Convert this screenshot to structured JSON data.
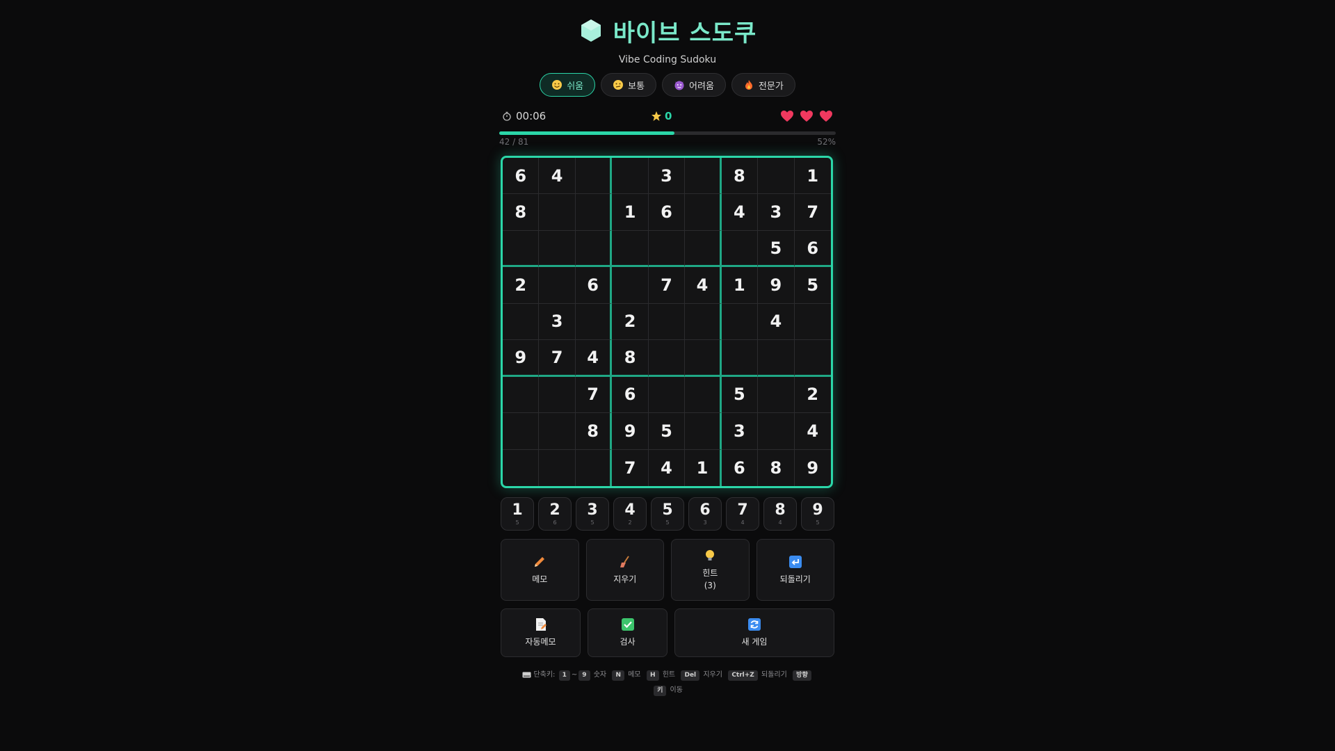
{
  "app": {
    "title": "바이브 스도쿠",
    "subtitle": "Vibe Coding Sudoku",
    "accent": "#2bd6a8"
  },
  "difficulty": [
    {
      "label": "쉬움",
      "icon": "smile-emoji-icon",
      "active": true
    },
    {
      "label": "보통",
      "icon": "thinking-emoji-icon",
      "active": false
    },
    {
      "label": "어려움",
      "icon": "devil-emoji-icon",
      "active": false
    },
    {
      "label": "전문가",
      "icon": "fire-emoji-icon",
      "active": false
    }
  ],
  "status": {
    "timer": "00:06",
    "score": "0",
    "lives": 3
  },
  "progress": {
    "label": "42 / 81",
    "percent_label": "52%",
    "fraction": 0.52
  },
  "grid": [
    [
      "6",
      "4",
      "",
      "",
      "3",
      "",
      "8",
      "",
      "1"
    ],
    [
      "8",
      "",
      "",
      "1",
      "6",
      "",
      "4",
      "3",
      "7"
    ],
    [
      "",
      "",
      "",
      "",
      "",
      "",
      "",
      "5",
      "6"
    ],
    [
      "2",
      "",
      "6",
      "",
      "7",
      "4",
      "1",
      "9",
      "5"
    ],
    [
      "",
      "3",
      "",
      "2",
      "",
      "",
      "",
      "4",
      ""
    ],
    [
      "9",
      "7",
      "4",
      "8",
      "",
      "",
      "",
      "",
      ""
    ],
    [
      "",
      "",
      "7",
      "6",
      "",
      "",
      "5",
      "",
      "2"
    ],
    [
      "",
      "",
      "8",
      "9",
      "5",
      "",
      "3",
      "",
      "4"
    ],
    [
      "",
      "",
      "",
      "7",
      "4",
      "1",
      "6",
      "8",
      "9"
    ]
  ],
  "numpad": [
    {
      "value": "1",
      "count": "5"
    },
    {
      "value": "2",
      "count": "6"
    },
    {
      "value": "3",
      "count": "5"
    },
    {
      "value": "4",
      "count": "2"
    },
    {
      "value": "5",
      "count": "5"
    },
    {
      "value": "6",
      "count": "3"
    },
    {
      "value": "7",
      "count": "4"
    },
    {
      "value": "8",
      "count": "4"
    },
    {
      "value": "9",
      "count": "5"
    }
  ],
  "actions": {
    "memo": "메모",
    "erase": "지우기",
    "hint": "힌트",
    "hint_count": "(3)",
    "undo": "되돌리기",
    "auto_memo": "자동메모",
    "check": "검사",
    "new_game": "새 게임"
  },
  "shortcuts": {
    "prefix": "단축키:",
    "k_1": "1",
    "tilde": "~",
    "k_9": "9",
    "number": "숫자",
    "k_n": "N",
    "memo": "메모",
    "k_h": "H",
    "hint": "힌트",
    "k_del": "Del",
    "erase": "지우기",
    "k_ctrlz": "Ctrl+Z",
    "undo": "되돌리기",
    "k_dir": "방향",
    "k_dir2": "키",
    "move": "이동"
  }
}
